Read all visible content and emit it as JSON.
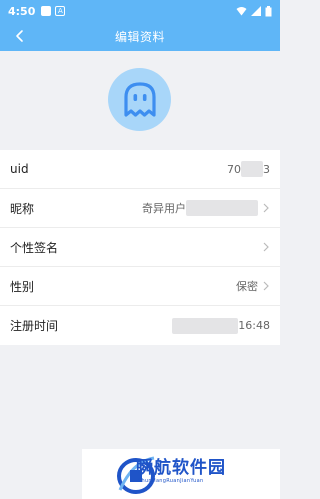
{
  "status_bar": {
    "time": "4:50",
    "left_icons": [
      "notification-box-icon",
      "a-box-icon"
    ],
    "right_icons": [
      "wifi-icon",
      "signal-icon",
      "battery-icon"
    ],
    "a_box_label": "A"
  },
  "header": {
    "title": "编辑资料",
    "back_icon": "chevron-left-icon",
    "background": "#5fb6f7"
  },
  "avatar": {
    "icon": "ghost-icon",
    "background": "#a8d6f9",
    "icon_color": "#3d8ef0"
  },
  "profile_rows": [
    {
      "label": "uid",
      "value_prefix": "70",
      "value_suffix": "3",
      "has_chevron": false
    },
    {
      "label": "昵称",
      "value_prefix": "奇异用户",
      "value_suffix": "",
      "has_chevron": true
    },
    {
      "label": "个性签名",
      "value_prefix": "",
      "value_suffix": "",
      "has_chevron": true
    },
    {
      "label": "性别",
      "value_prefix": "保密",
      "value_suffix": "",
      "has_chevron": true
    },
    {
      "label": "注册时间",
      "value_prefix": "",
      "value_suffix": "16:48",
      "has_chevron": false
    }
  ],
  "watermark": {
    "title": "瞬航软件园",
    "subtitle": "ShunHangRuanJianYuan",
    "color": "#1f54c8"
  }
}
